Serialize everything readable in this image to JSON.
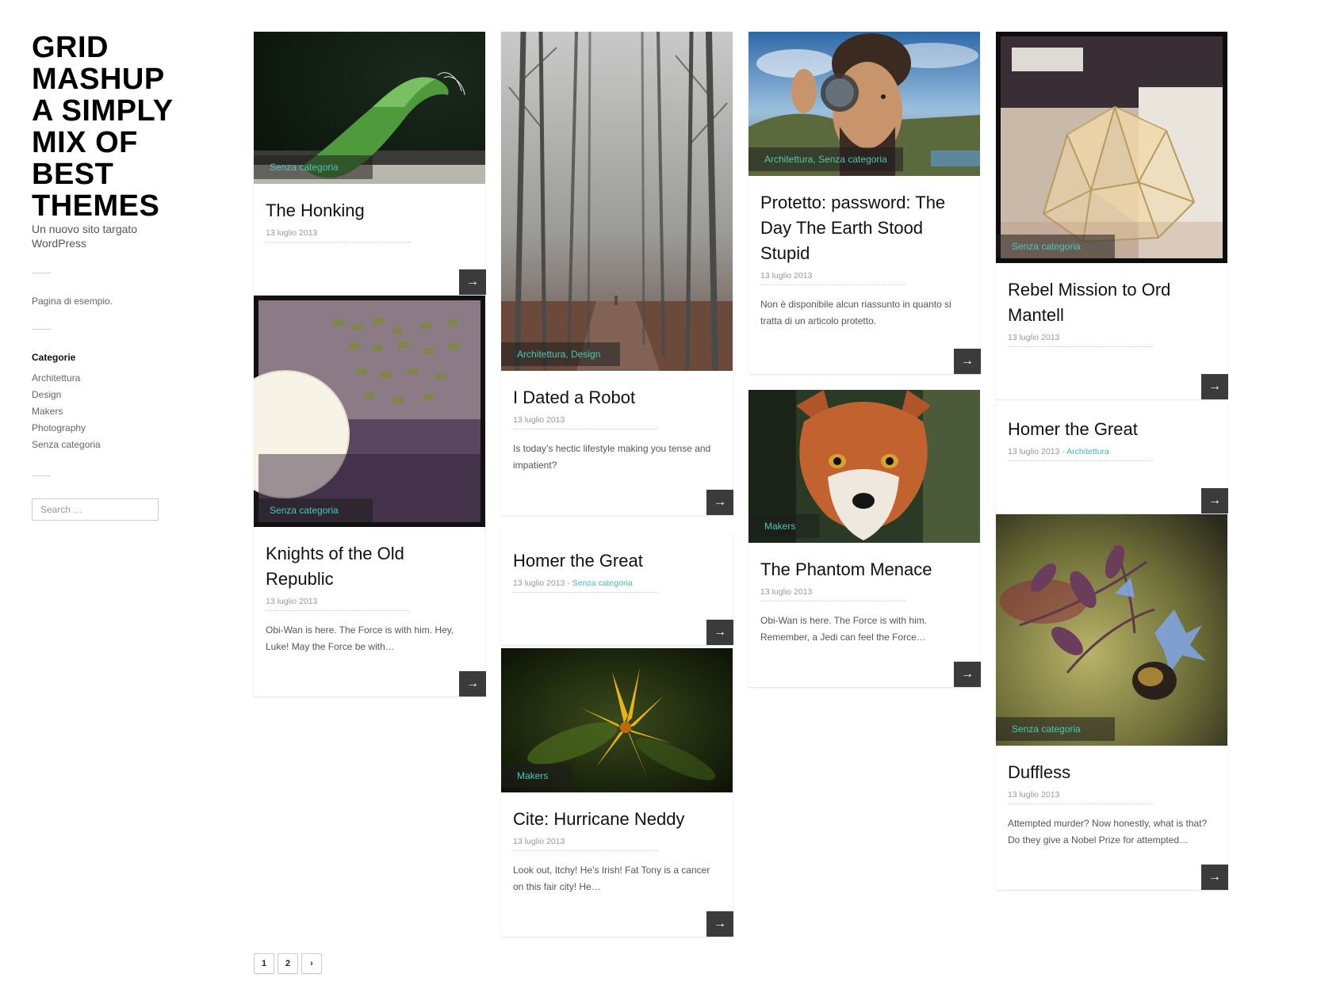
{
  "site": {
    "title_lines": [
      "GRID",
      "MASHUP",
      "A SIMPLY",
      "MIX OF",
      "BEST",
      "THEMES"
    ],
    "tagline": "Un nuovo sito targato WordPress",
    "page_link": "Pagina di esempio."
  },
  "categories": {
    "title": "Categorie",
    "items": [
      "Architettura",
      "Design",
      "Makers",
      "Photography",
      "Senza categoria"
    ]
  },
  "search": {
    "placeholder": "Search …"
  },
  "more_arrow": "→",
  "colors": {
    "accent": "#3cbfa8",
    "button_bg": "#3b3b3b"
  },
  "posts": [
    {
      "title": "The Honking",
      "date": "13 luglio 2013",
      "category": "Senza categoria",
      "image": "green-leaf"
    },
    {
      "title": "Knights of the Old Republic",
      "date": "13 luglio 2013",
      "category": "Senza categoria",
      "image": "paper-lamp-wall",
      "excerpt": "Obi-Wan is here. The Force is with him. Hey, Luke! May the Force be with…"
    },
    {
      "title": "I Dated a Robot",
      "date": "13 luglio 2013",
      "category": "Architettura, Design",
      "image": "foggy-forest",
      "excerpt": "Is today’s hectic lifestyle making you tense and impatient?"
    },
    {
      "title": "Homer the Great",
      "date": "13 luglio 2013",
      "meta_sep": " - ",
      "meta_category": "Senza categoria"
    },
    {
      "title": "Cite: Hurricane Neddy",
      "date": "13 luglio 2013",
      "category": "Makers",
      "image": "yellow-flower",
      "excerpt": "Look out, Itchy! He’s Irish! Fat Tony is a cancer on this fair city! He…"
    },
    {
      "title": "Protetto: password: The Day The Earth Stood Stupid",
      "date": "13 luglio 2013",
      "category": "Architettura, Senza categoria",
      "image": "man-with-lens",
      "excerpt": "Non è disponibile alcun riassunto in quanto si tratta di un articolo protetto."
    },
    {
      "title": "The Phantom Menace",
      "date": "13 luglio 2013",
      "category": "Makers",
      "image": "fox",
      "excerpt": "Obi-Wan is here. The Force is with him. Remember, a Jedi can feel the Force…"
    },
    {
      "title": "Rebel Mission to Ord Mantell",
      "date": "13 luglio 2013",
      "category": "Senza categoria",
      "image": "paper-dome"
    },
    {
      "title": "Homer the Great",
      "date": "13 luglio 2013",
      "meta_sep": " - ",
      "meta_category": "Architettura"
    },
    {
      "title": "Duffless",
      "date": "13 luglio 2013",
      "category": "Senza categoria",
      "image": "borage-bee",
      "excerpt": "Attempted murder? Now honestly, what is that? Do they give a Nobel Prize for attempted…"
    }
  ],
  "pagination": {
    "pages": [
      "1",
      "2"
    ],
    "next": "›"
  }
}
